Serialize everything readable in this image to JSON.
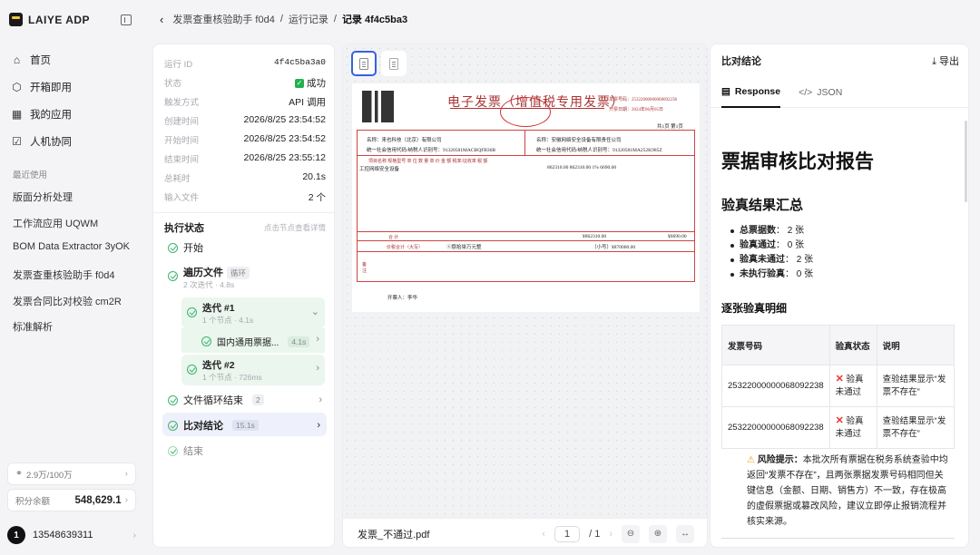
{
  "brand": {
    "name": "LAIYE ADP"
  },
  "nav": [
    {
      "icon": "⌂",
      "label": "首页",
      "name": "home"
    },
    {
      "icon": "⬡",
      "label": "开箱即用",
      "name": "out-of-box"
    },
    {
      "icon": "▦",
      "label": "我的应用",
      "name": "my-apps"
    },
    {
      "icon": "☑",
      "label": "人机协同",
      "name": "human-collab"
    }
  ],
  "recent": {
    "label": "最近使用",
    "items": [
      "版面分析处理",
      "工作流应用 UQWM",
      "BOM Data Extractor 3yOK",
      "发票查重核验助手 f0d4",
      "发票合同比对校验 cm2R",
      "标准解析"
    ]
  },
  "quota": {
    "text": "2.9万/100万"
  },
  "balance": {
    "label": "积分余额",
    "value": "548,629.1"
  },
  "user": {
    "avatar": "1",
    "name": "13548639311"
  },
  "breadcrumb": {
    "app": "发票查重核验助手 f0d4",
    "sep1": "/",
    "runs": "运行记录",
    "sep2": "/",
    "current": "记录 4f4c5ba3"
  },
  "run": {
    "fields": [
      {
        "k": "运行 ID",
        "v": "4f4c5ba3a0",
        "mono": true
      },
      {
        "k": "状态",
        "v": "成功"
      },
      {
        "k": "触发方式",
        "v": "API 调用"
      },
      {
        "k": "创建时间",
        "v": "2026/8/25 23:54:52"
      },
      {
        "k": "开始时间",
        "v": "2026/8/25 23:54:52"
      },
      {
        "k": "结束时间",
        "v": "2026/8/25 23:55:12"
      },
      {
        "k": "总耗时",
        "v": "20.1s"
      },
      {
        "k": "输入文件",
        "v": "2 个"
      }
    ],
    "exec_title": "执行状态",
    "exec_hint": "点击节点查看详情",
    "steps": {
      "start": "开始",
      "loop": {
        "label": "遍历文件",
        "tag": "循环",
        "sub": "2 次迭代 · 4.8s"
      },
      "iter1": {
        "label": "迭代 #1",
        "sub": "1 个节点 · 4.1s"
      },
      "iter1_child": {
        "label": "国内通用票据...",
        "tag": "4.1s"
      },
      "iter2": {
        "label": "迭代 #2",
        "sub": "1 个节点 · 726ms"
      },
      "loop_end": {
        "label": "文件循环结束",
        "tag": "2"
      },
      "compare": {
        "label": "比对结论",
        "tag": "15.1s"
      },
      "end": "结束"
    }
  },
  "viewer": {
    "filename": "发票_不通过.pdf",
    "page": "1",
    "total": "/ 1",
    "invoice": {
      "title": "电子发票（增值税专用发票）",
      "no_label": "发票号码：25322000000068092238",
      "date_label": "开票日期：2024年06月05日",
      "pages": "共1页 第1页",
      "buyer": "名称：来也科技（北京）有限公司",
      "buyer_tax": "统一社会信用代码/纳税人识别号：91320581MACBQFB36B",
      "seller": "名称：安徽网络安全设备有限责任公司",
      "seller_tax": "统一社会信用代码/纳税人识别号：91320581MA252K985Z",
      "headers": "项目名称    规格型号    单 位    数 量    单 价    金 额    税率/征收率    税 额",
      "item": "工控网络安全设备",
      "amounts": "862310.00    862310.00    1%    6690.00",
      "sum_label": "合        计",
      "sum_amount": "¥862310.00",
      "sum_tax": "¥6690.00",
      "total_label": "价税合计（大写）",
      "total_cn": "ⓧ捌拾柒万元整",
      "total_small": "（小写）¥870000.00",
      "remark": "备注",
      "drawer": "开票人：李华"
    }
  },
  "result": {
    "title": "比对结论",
    "export": "导出",
    "tabs": [
      "Response",
      "JSON"
    ],
    "h1": "票据审核比对报告",
    "summary_title": "验真结果汇总",
    "summary": [
      {
        "k": "总票据数",
        "v": "2 张"
      },
      {
        "k": "验真通过",
        "v": "0 张"
      },
      {
        "k": "验真未通过",
        "v": "2 张"
      },
      {
        "k": "未执行验真",
        "v": "0 张"
      }
    ],
    "detail_title": "逐张验真明细",
    "cols": [
      "发票号码",
      "验真状态",
      "说明"
    ],
    "rows": [
      {
        "no": "25322000000068092238",
        "status": "验真未通过",
        "note": "查验结果显示“发票不存在”"
      },
      {
        "no": "25322000000068092238",
        "status": "验真未通过",
        "note": "查验结果显示“发票不存在”"
      }
    ],
    "risk_label": "风险提示：",
    "risk_text": "本批次所有票据在税务系统查验中均返回“发票不存在”，且两张票据发票号码相同但关键信息（金额、日期、销售方）不一致，存在极高的虚假票据或篡改风险，建议立即停止报销流程并核实来源。"
  }
}
